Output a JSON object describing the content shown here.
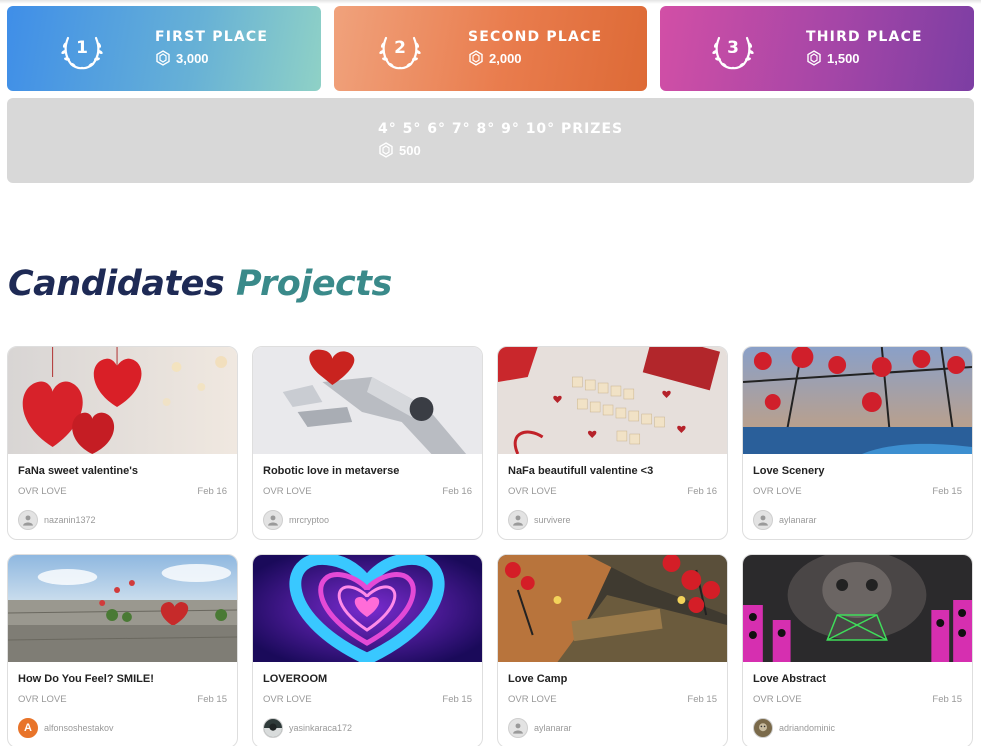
{
  "prizes": [
    {
      "rank": "1",
      "title": "FIRST PLACE",
      "amount": "3,000"
    },
    {
      "rank": "2",
      "title": "SECOND PLACE",
      "amount": "2,000"
    },
    {
      "rank": "3",
      "title": "THIRD PLACE",
      "amount": "1,500"
    }
  ],
  "other_prizes": {
    "title": "4° 5° 6° 7° 8° 9° 10° PRIZES",
    "amount": "500"
  },
  "heading": {
    "word1": "Candidates",
    "word2": "Projects"
  },
  "projects": [
    {
      "title": "FaNa sweet valentine's",
      "category": "OVR LOVE",
      "date": "Feb 16",
      "user": "nazanin1372"
    },
    {
      "title": "Robotic love in metaverse",
      "category": "OVR LOVE",
      "date": "Feb 16",
      "user": "mrcryptoo"
    },
    {
      "title": "NaFa beautifull valentine <3",
      "category": "OVR LOVE",
      "date": "Feb 16",
      "user": "survivere"
    },
    {
      "title": "Love Scenery",
      "category": "OVR LOVE",
      "date": "Feb 15",
      "user": "aylanarar"
    },
    {
      "title": "How Do You Feel? SMILE!",
      "category": "OVR LOVE",
      "date": "Feb 15",
      "user": "alfonsoshestakov",
      "avatar_letter": "A"
    },
    {
      "title": "LOVEROOM",
      "category": "OVR LOVE",
      "date": "Feb 15",
      "user": "yasinkaraca172"
    },
    {
      "title": "Love Camp",
      "category": "OVR LOVE",
      "date": "Feb 15",
      "user": "aylanarar"
    },
    {
      "title": "Love Abstract",
      "category": "OVR LOVE",
      "date": "Feb 15",
      "user": "adriandominic"
    }
  ],
  "colors": {
    "heading_dark": "#1e2a55",
    "heading_teal": "#3a8a8a",
    "first": "#3f8ee8",
    "second": "#e97c4d",
    "third": "#a546a7",
    "other": "#d8d8d8"
  },
  "icons": {
    "rank": "laurel-wreath-icon",
    "amount": "ovr-coin-icon",
    "user": "user-avatar-icon"
  }
}
